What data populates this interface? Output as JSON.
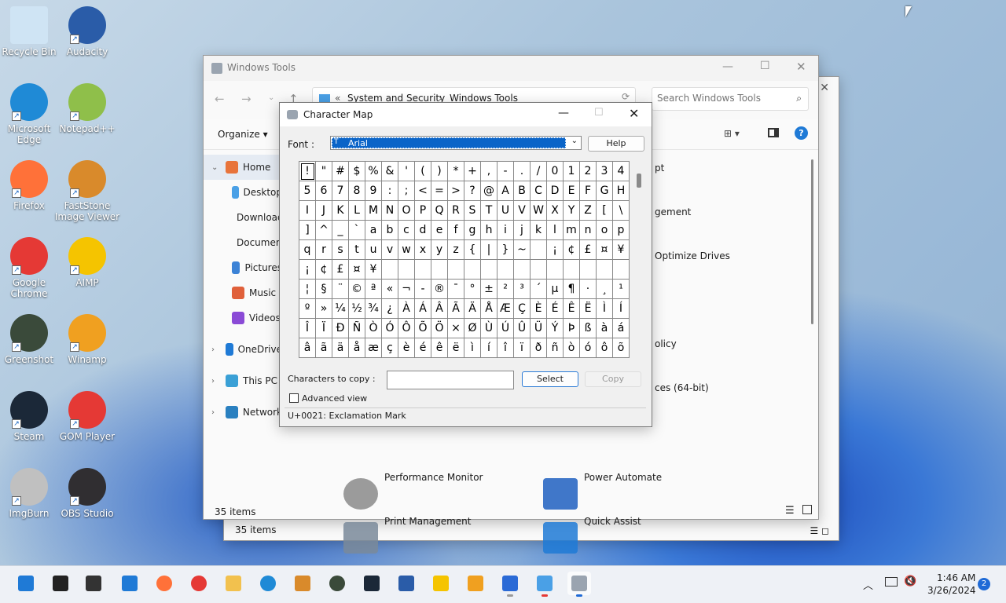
{
  "desktop": {
    "icons": [
      {
        "name": "recycle-bin-icon",
        "label": "Recycle Bin",
        "color": "#cfe4f4"
      },
      {
        "name": "audacity-icon",
        "label": "Audacity",
        "color": "#2a5ca8"
      },
      {
        "name": "edge-icon",
        "label": "Microsoft Edge",
        "color": "#1f8ad6"
      },
      {
        "name": "notepadpp-icon",
        "label": "Notepad++",
        "color": "#8fbf4a"
      },
      {
        "name": "firefox-icon",
        "label": "Firefox",
        "color": "#ff7139"
      },
      {
        "name": "faststone-icon",
        "label": "FastStone Image Viewer",
        "color": "#d98a2b"
      },
      {
        "name": "chrome-icon",
        "label": "Google Chrome",
        "color": "#e53935"
      },
      {
        "name": "aimp-icon",
        "label": "AIMP",
        "color": "#f5c400"
      },
      {
        "name": "greenshot-icon",
        "label": "Greenshot",
        "color": "#3a4a3a"
      },
      {
        "name": "winamp-icon",
        "label": "Winamp",
        "color": "#f0a020"
      },
      {
        "name": "steam-icon",
        "label": "Steam",
        "color": "#1b2838"
      },
      {
        "name": "gom-player-icon",
        "label": "GOM Player",
        "color": "#e53935"
      },
      {
        "name": "imgburn-icon",
        "label": "ImgBurn",
        "color": "#c0c0c0"
      },
      {
        "name": "obs-icon",
        "label": "OBS Studio",
        "color": "#302e31"
      }
    ]
  },
  "explorer": {
    "title": "Windows Tools",
    "breadcrumb": [
      "System and Security",
      "Windows Tools"
    ],
    "breadcrumb_sep": "«",
    "search_placeholder": "Search Windows Tools",
    "organize_label": "Organize",
    "status": "35 items",
    "status_back": "35 items",
    "nav": [
      {
        "label": "Home",
        "icon": "home-icon",
        "color": "#e8743b"
      },
      {
        "label": "Desktop",
        "icon": "desktop-icon",
        "color": "#4aa0e6"
      },
      {
        "label": "Downloads",
        "icon": "download-icon",
        "color": "#2e9a4f"
      },
      {
        "label": "Documents",
        "icon": "document-icon",
        "color": "#7a8a9a"
      },
      {
        "label": "Pictures",
        "icon": "pictures-icon",
        "color": "#3b82d6"
      },
      {
        "label": "Music",
        "icon": "music-icon",
        "color": "#e0603a"
      },
      {
        "label": "Videos",
        "icon": "videos-icon",
        "color": "#8a4ad6"
      },
      {
        "label": "OneDrive",
        "icon": "onedrive-icon",
        "color": "#1f7ad6"
      },
      {
        "label": "This PC",
        "icon": "this-pc-icon",
        "color": "#3aa0d6"
      },
      {
        "label": "Network",
        "icon": "network-icon",
        "color": "#2a80c0"
      }
    ],
    "items_partial": [
      "pt",
      "gement",
      "Optimize Drives",
      "olicy",
      "ces (64-bit)"
    ],
    "items": [
      {
        "label": "Performance Monitor",
        "icon": "performance-monitor-icon"
      },
      {
        "label": "Power Automate",
        "icon": "power-automate-icon"
      },
      {
        "label": "Print Management",
        "icon": "print-management-icon"
      },
      {
        "label": "Quick Assist",
        "icon": "quick-assist-icon"
      }
    ]
  },
  "charmap": {
    "title": "Character Map",
    "font_label": "Font :",
    "font_value": "Arial",
    "help_label": "Help",
    "chars_label": "Characters to copy :",
    "chars_value": "",
    "select_label": "Select",
    "copy_label": "Copy",
    "advanced_label": "Advanced view",
    "status": "U+0021: Exclamation Mark",
    "grid": "!\"#$%&'()*+,-./01234 56789:;<=>?@ABCDEFGH IJKLMNOPQRSTUVWXYZ[\\ ]^_`abcdefghijklmnop qrstuvwxyz{|}~ ¡¢£¤¥ ¦§¨©ª«¬-®¯°±²³´µ¶·¸¹ º»¼½¾¿ÀÁÂÃÄÅÆÇÈÉÊËÌÍ ÎÏÐÑÒÓÔÕÖ×ØÙÚÛÜÝÞßàá âãäåæçèéêëìíîïðñòóôõ ö÷øùúûüýþÿĀāĂăĄąĆćĈĉ",
    "grid_fallback_row5": [
      "q",
      "r",
      "s",
      "t",
      "u",
      "v",
      "w",
      "x",
      "y",
      "z",
      "{",
      "|",
      "}",
      "~",
      " ",
      "¡",
      "¢",
      "£",
      "¤",
      "¥"
    ]
  },
  "taskbar": {
    "time": "1:46 AM",
    "date": "3/26/2024",
    "notification_count": "2",
    "apps": [
      {
        "name": "start-icon",
        "color": "#1f7ad6"
      },
      {
        "name": "search-icon",
        "color": "#222222"
      },
      {
        "name": "task-view-icon",
        "color": "#333333"
      },
      {
        "name": "widgets-icon",
        "color": "#1f7ad6"
      },
      {
        "name": "firefox-taskbar-icon",
        "color": "#ff7139"
      },
      {
        "name": "chrome-taskbar-icon",
        "color": "#e53935"
      },
      {
        "name": "file-explorer-icon",
        "color": "#f2c14e"
      },
      {
        "name": "edge-taskbar-icon",
        "color": "#1f8ad6"
      },
      {
        "name": "faststone-taskbar-icon",
        "color": "#d98a2b"
      },
      {
        "name": "greenshot-taskbar-icon",
        "color": "#3a4a3a"
      },
      {
        "name": "steam-taskbar-icon",
        "color": "#1b2838"
      },
      {
        "name": "audacity-taskbar-icon",
        "color": "#2a5ca8"
      },
      {
        "name": "aimp-taskbar-icon",
        "color": "#f5c400"
      },
      {
        "name": "winamp-taskbar-icon",
        "color": "#f0a020"
      },
      {
        "name": "store-icon",
        "color": "#2a6ad6"
      },
      {
        "name": "control-panel-icon",
        "color": "#4aa0e6"
      },
      {
        "name": "charmap-taskbar-icon",
        "color": "#9aa4b0"
      }
    ]
  }
}
